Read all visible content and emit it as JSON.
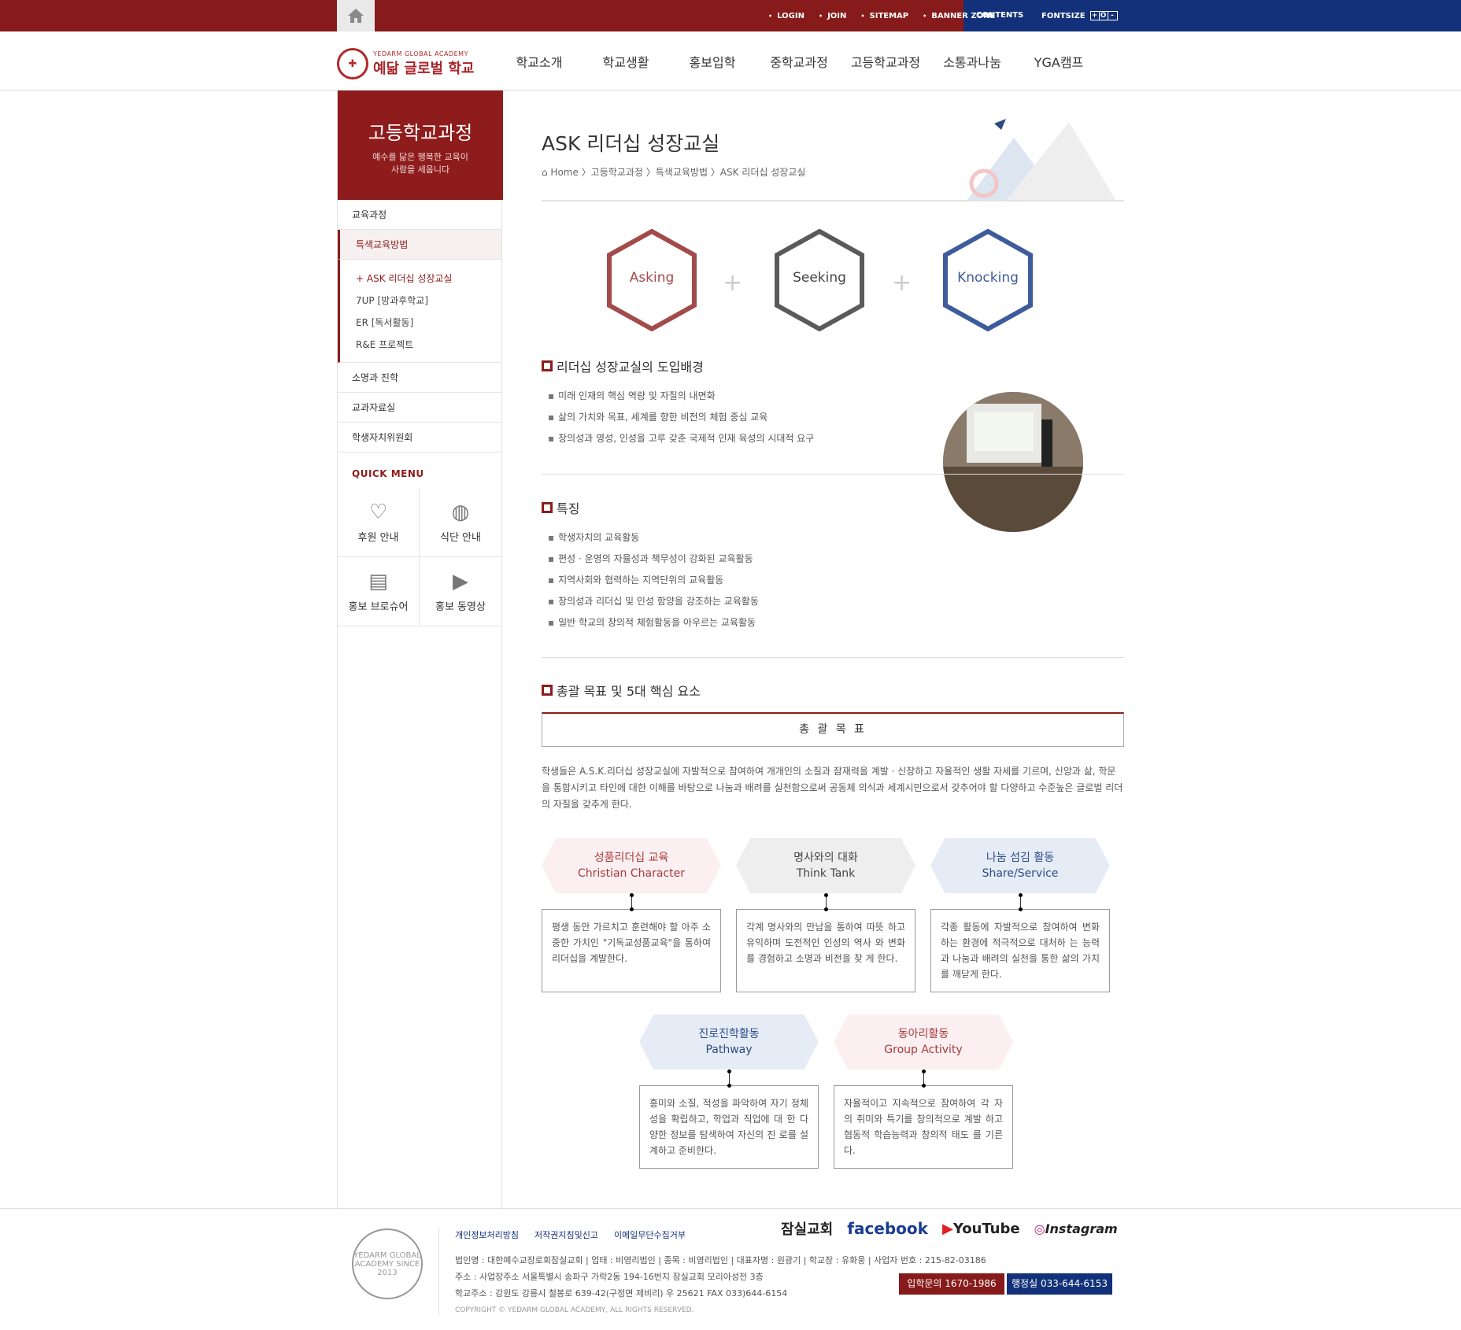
{
  "topbar": {
    "links": [
      "LOGIN",
      "JOIN",
      "SITEMAP",
      "BANNER ZONE"
    ],
    "contents": "CONTENTS",
    "fontsize_label": "FONTSIZE",
    "fontsize_btns": [
      "+",
      "O",
      "-"
    ],
    "colors": {
      "red": "#871a1a",
      "blue": "#12317a"
    }
  },
  "logo": {
    "en": "YEDARM GLOBAL ACADEMY",
    "ko": "예닮 글로벌 학교"
  },
  "gnb": [
    "학교소개",
    "학교생활",
    "홍보입학",
    "중학교과정",
    "고등학교과정",
    "소통과나눔",
    "YGA캠프"
  ],
  "side": {
    "title": "고등학교과정",
    "subtitle1": "예수를 닮은 행복한 교육이",
    "subtitle2": "사람을 세웁니다",
    "item1": "교육과정",
    "item2": "특색교육방법",
    "subs": [
      "+ ASK 리더십 성장교실",
      "7UP [방과후학교]",
      "ER [독서활동]",
      "R&E 프로젝트"
    ],
    "item3": "소명과 진학",
    "item4": "교과자료실",
    "item5": "학생자치위원회",
    "quick_title": "QUICK MENU",
    "quick": [
      "후원 안내",
      "식단 안내",
      "홍보 브로슈어",
      "홍보 동영상"
    ]
  },
  "main": {
    "title": "ASK 리더십 성장교실",
    "breadcrumb": "⌂ Home 〉고등학교과정 〉특색교육방법 〉ASK 리더십 성장교실",
    "hex": [
      "Asking",
      "Seeking",
      "Knocking"
    ],
    "sec1_title": "리더십 성장교실의 도입배경",
    "sec1_items": [
      "미래 인재의 핵심 역량 및 자질의 내면화",
      "삶의 가치와 목표, 세계를 향한 비전의 체험 중심 교육",
      "창의성과 영성, 인성을 고루 갖춘 국제적 인재 육성의 시대적 요구"
    ],
    "sec2_title": "특징",
    "sec2_items": [
      "학생자치의 교육활동",
      "편성 · 운영의 자율성과 책무성이 강화된 교육활동",
      "지역사회와 협력하는 지역단위의 교육활동",
      "창의성과 리더십 및 인성 함양을 강조하는 교육활동",
      "일반 학교의 창의적 체험활동을 아우르는 교육활동"
    ],
    "sec3_title": "총괄 목표 및 5대 핵심 요소",
    "goal_label": "총 괄 목 표",
    "goal_desc": "학생들은 A.S.K.리더십 성장교실에 자발적으로 참여하여 개개인의 소질과 잠재력을 계발 · 신장하고 자율적인 생활 자세를 기르며, 신앙과 삶, 학문을 통합시키고 타인에 대한 이해를 바탕으로 나눔과 배려를 실천함으로써 공동체 의식과 세계시민으로서 갖추어야 할 다양하고 수준높은 글로벌 리더의 자질을 갖추게 한다.",
    "elements": [
      {
        "ko": "성품리더십 교육",
        "en": "Christian Character",
        "desc": "평생 동안 가르치고 훈련해야 할 아주 소중한 가치인 \"기독교성품교육\"을 통하여 리더십을 계발한다."
      },
      {
        "ko": "명사와의 대화",
        "en": "Think Tank",
        "desc": "각계 명사와의 만남을 통하여 따뜻 하고 유익하며 도전적인 인성의 역사 와 변화를 경험하고 소명과 비전을 찾 게 한다."
      },
      {
        "ko": "나눔 섬김 활동",
        "en": "Share/Service",
        "desc": "각종 활동에 자발적으로 참여하여 변화하는 환경에 적극적으로 대처하 는 능력과 나눔과 배려의 실천을 통한 삶의 가치를 깨닫게 한다."
      },
      {
        "ko": "진로진학활동",
        "en": "Pathway",
        "desc": "흥미와 소질, 적성을 파악하여 자기 정체성을 확립하고, 학업과 직업에 대 한 다양한 정보를 탐색하여 자신의 진 로를 설계하고 준비한다."
      },
      {
        "ko": "동아리활동",
        "en": "Group Activity",
        "desc": "자율적이고 지속적으로 참여하여 각 자의 취미와 특기를 창의적으로 계발 하고 협동적 학습능력과 창의적 태도 를 기른다."
      }
    ]
  },
  "footer": {
    "links": [
      "개인정보처리방침",
      "저작권지침및신고",
      "이메일무단수집거부"
    ],
    "info1": "법인명 : 대한예수교장로회잠실교회  |  업태 : 비영리법인  |  종목 : 비영리법인  |  대표자명 : 원광기  |  학교장 : 유화웅  |  사업자 번호 : 215-82-03186",
    "info2": "주소 : 사업장주소 서울특별시 송파구 가락2동 194-16번지 잠실교회 모리아성전 3층",
    "info3": "학교주소 : 강원도 강릉시 철봉로 639-42(구정면 제비리) 우 25621 FAX 033)644-6154",
    "copyright": "COPYRIGHT © YEDARM GLOBAL ACADEMY, ALL RIGHTS RESERVED.",
    "sns": [
      "잠실교회",
      "facebook",
      "YouTube",
      "Instagram"
    ],
    "tel1": "입학문의 1670-1986",
    "tel2": "행정실 033-644-6153",
    "seal": "YEDARM GLOBAL ACADEMY SINCE 2013"
  }
}
